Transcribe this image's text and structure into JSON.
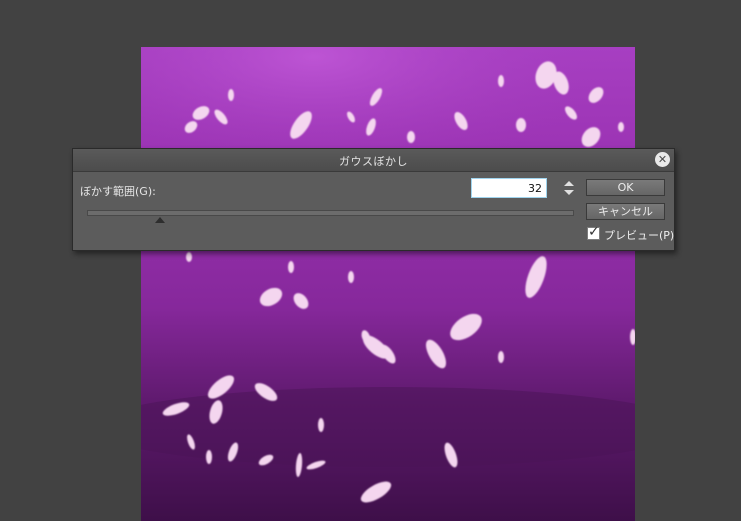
{
  "dialog": {
    "title": "ガウスぼかし",
    "close_icon": "close-icon",
    "field_label": "ぼかす範囲(G):",
    "value": "32",
    "slider_value": 32,
    "ok_label": "OK",
    "cancel_label": "キャンセル",
    "preview_label": "プレビュー(P)",
    "preview_checked": true
  },
  "colors": {
    "workspace": "#424242",
    "dialog_bg": "#5c5c5c",
    "canvas_purple": "#a23cbc",
    "petal": "#f4d6ef"
  }
}
